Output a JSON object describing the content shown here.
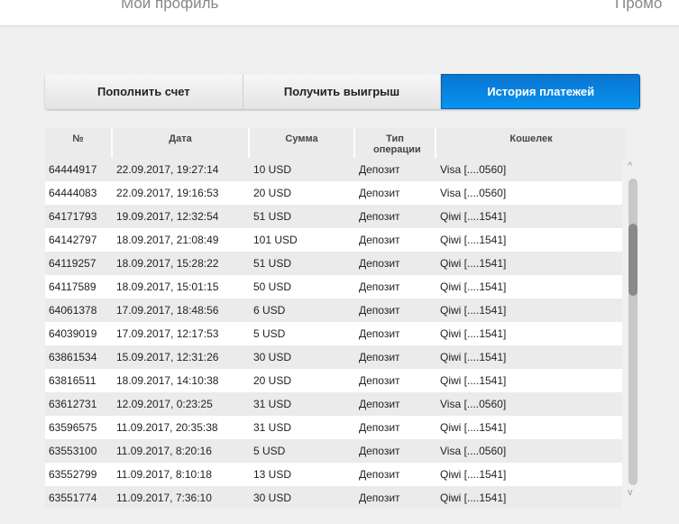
{
  "nav": {
    "profile": "Мой профиль",
    "promo": "Промо"
  },
  "tabs": [
    {
      "label": "Пополнить счет"
    },
    {
      "label": "Получить выигрыш"
    },
    {
      "label": "История платежей"
    }
  ],
  "columns": [
    "№",
    "Дата",
    "Сумма",
    "Тип операции",
    "Кошелек"
  ],
  "rows": [
    [
      "64444917",
      "22.09.2017, 19:27:14",
      "10 USD",
      "Депозит",
      "Visa [....0560]"
    ],
    [
      "64444083",
      "22.09.2017, 19:16:53",
      "20 USD",
      "Депозит",
      "Visa [....0560]"
    ],
    [
      "64171793",
      "19.09.2017, 12:32:54",
      "51 USD",
      "Депозит",
      "Qiwi [....1541]"
    ],
    [
      "64142797",
      "18.09.2017, 21:08:49",
      "101 USD",
      "Депозит",
      "Qiwi [....1541]"
    ],
    [
      "64119257",
      "18.09.2017, 15:28:22",
      "51 USD",
      "Депозит",
      "Qiwi [....1541]"
    ],
    [
      "64117589",
      "18.09.2017, 15:01:15",
      "50 USD",
      "Депозит",
      "Qiwi [....1541]"
    ],
    [
      "64061378",
      "17.09.2017, 18:48:56",
      "6 USD",
      "Депозит",
      "Qiwi [....1541]"
    ],
    [
      "64039019",
      "17.09.2017, 12:17:53",
      "5 USD",
      "Депозит",
      "Qiwi [....1541]"
    ],
    [
      "63861534",
      "15.09.2017, 12:31:26",
      "30 USD",
      "Депозит",
      "Qiwi [....1541]"
    ],
    [
      "63816511",
      "18.09.2017, 14:10:38",
      "20 USD",
      "Депозит",
      "Qiwi [....1541]"
    ],
    [
      "63612731",
      "12.09.2017, 0:23:25",
      "31 USD",
      "Депозит",
      "Visa [....0560]"
    ],
    [
      "63596575",
      "11.09.2017, 20:35:38",
      "31 USD",
      "Депозит",
      "Qiwi [....1541]"
    ],
    [
      "63553100",
      "11.09.2017, 8:20:16",
      "5 USD",
      "Депозит",
      "Visa [....0560]"
    ],
    [
      "63552799",
      "11.09.2017, 8:10:18",
      "13 USD",
      "Депозит",
      "Qiwi [....1541]"
    ],
    [
      "63551774",
      "11.09.2017, 7:36:10",
      "30 USD",
      "Депозит",
      "Qiwi [....1541]"
    ]
  ],
  "scroll_glyphs": {
    "up": "^",
    "down": "v"
  },
  "colors": {
    "accent": "#0a84e0"
  }
}
